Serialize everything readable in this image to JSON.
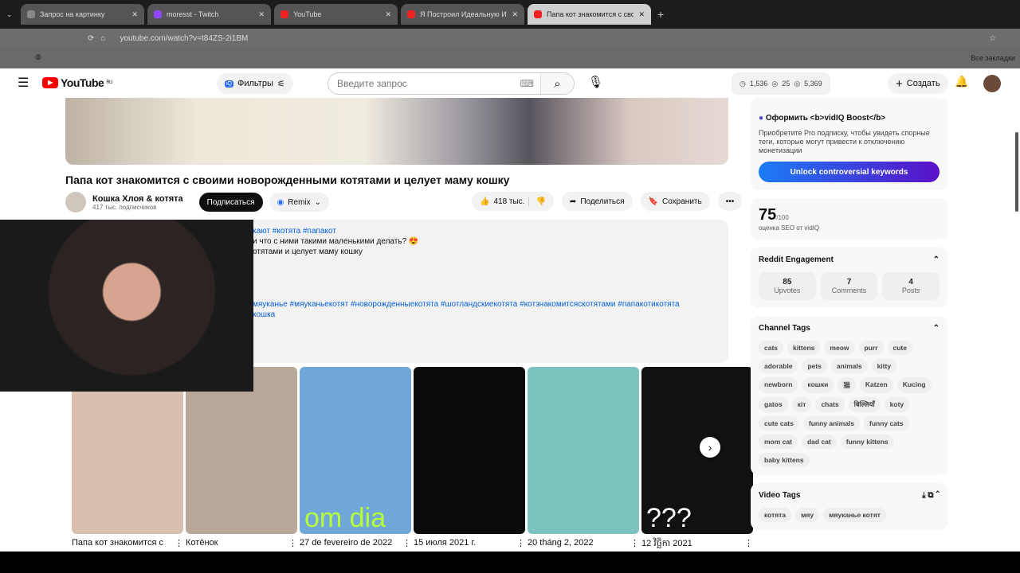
{
  "browser": {
    "tabs": [
      {
        "label": "Запрос на картинку"
      },
      {
        "label": "moresst - Twitch"
      },
      {
        "label": "YouTube"
      },
      {
        "label": "Я Построил Идеальную Игру"
      },
      {
        "label": "Папа кот знакомится с сво"
      }
    ],
    "url": "youtube.com/watch?v=t84ZS-2i1BM",
    "bookmarks_label": "Все закладки"
  },
  "header": {
    "logo": "YouTube",
    "region": "RU",
    "filters": "Фильтры",
    "search_placeholder": "Введите запрос",
    "stats": {
      "clock": "1,536",
      "views1": "25",
      "views2": "5,369"
    },
    "create": "Создать"
  },
  "video": {
    "title": "Папа кот знакомится с своими новорожденными котятами и целует маму кошку",
    "channel": "Кошка Хлоя & котята",
    "subs": "417 тыс. подписчиков",
    "subscribe": "Подписаться",
    "remix": "Remix",
    "likes": "418 тыс.",
    "share": "Поделиться",
    "save": "Сохранить"
  },
  "description": {
    "line1": "кают #котята #папакот",
    "line2": "и что с ними такими маленькими делать? 😍",
    "line3": "отятами и целует маму кошку",
    "hashtags": "мяуканье #мяуканьекотят #новорожденныекотята #шотландскиекотята #котзнакомитсяскотятами #папакотикотята",
    "line5": "кошка"
  },
  "shorts": [
    {
      "title": "Папа кот знакомится с",
      "color": "#d9bfae"
    },
    {
      "title": "Котёнок",
      "color": "#b8a89a"
    },
    {
      "title": "27 de fevereiro de 2022",
      "color": "#6fa8d8",
      "overlay": "om dia"
    },
    {
      "title": "15 июля 2021 г.",
      "color": "#0b0b0b"
    },
    {
      "title": "20 tháng 2, 2022",
      "color": "#7cc3c0"
    },
    {
      "title": "12 វិច្ឆិកា 2021",
      "color": "#111",
      "overlay": "???"
    }
  ],
  "vidiq": {
    "boost_title": "Оформить <b>vidIQ Boost</b>",
    "boost_text": "Приобретите Pro подписку, чтобы увидеть спорные теги, которые могут привести к отключению монетизации",
    "unlock": "Unlock controversial keywords",
    "seo_score": "75",
    "seo_max": "/100",
    "seo_label": "оценка SEO от vidIQ",
    "reddit_title": "Reddit Engagement",
    "reddit": [
      {
        "value": "85",
        "label": "Upvotes"
      },
      {
        "value": "7",
        "label": "Comments"
      },
      {
        "value": "4",
        "label": "Posts"
      }
    ],
    "channel_tags_title": "Channel Tags",
    "channel_tags": [
      "cats",
      "kittens",
      "meow",
      "purr",
      "cute",
      "adorable",
      "pets",
      "animals",
      "kitty",
      "newborn",
      "кошки",
      "猫",
      "Katzen",
      "Kucing",
      "gatos",
      "кіт",
      "chats",
      "बिल्लियाँ",
      "koty",
      "cute cats",
      "funny animals",
      "funny cats",
      "mom cat",
      "dad cat",
      "funny kittens",
      "baby kittens"
    ],
    "video_tags_title": "Video Tags",
    "video_tags": [
      "котята",
      "мяу",
      "мяуканье котят"
    ]
  }
}
